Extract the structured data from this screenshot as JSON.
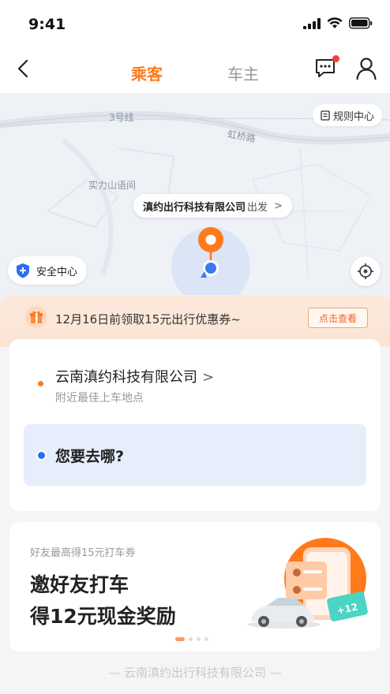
{
  "status": {
    "time": "9:41"
  },
  "nav": {
    "tab_passenger": "乘客",
    "tab_owner": "车主"
  },
  "map": {
    "labels": {
      "metro": "3号线",
      "road": "虹桥路",
      "poi": "实力山语间"
    },
    "rules_label": "规则中心",
    "pickup": {
      "name": "滇约出行科技有限公司",
      "suffix": "出发",
      "chevron": ">"
    },
    "safety_label": "安全中心"
  },
  "coupon": {
    "text": "12月16日前领取15元出行优惠券~",
    "button": "点击查看"
  },
  "route": {
    "origin_name": "云南滇约科技有限公司",
    "origin_chevron": ">",
    "origin_hint": "附近最佳上车地点",
    "destination_placeholder": "您要去哪?"
  },
  "promo": {
    "subtitle": "好友最高得15元打车券",
    "title_line1": "邀好友打车",
    "title_line2": "得12元现金奖励",
    "ticket_amount": "+12",
    "carousel_active": 1,
    "carousel_count": 4
  },
  "footer": "— 云南滇约出行科技有限公司 —",
  "colors": {
    "accent": "#ff7a1a",
    "blue": "#2a6ef0"
  }
}
